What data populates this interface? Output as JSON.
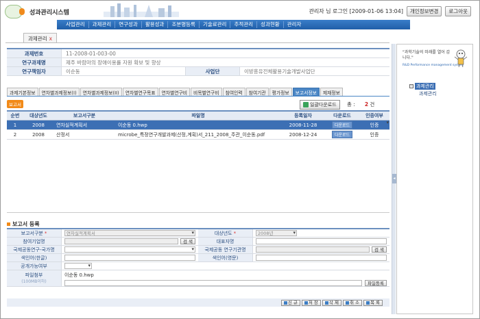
{
  "header": {
    "system_name": "성과관리시스템",
    "logo_text": "생각 누리",
    "user_status": "관리자 님 로그인 [2009-01-06 13:04]",
    "btn_profile": "개인정보변경",
    "btn_logout": "로그아웃"
  },
  "nav": [
    "사업관리",
    "과제관리",
    "연구성과",
    "활용성과",
    "조분명등록",
    "기술료관리",
    "추적관리",
    "성과현황",
    "관리자"
  ],
  "top_tab": {
    "label": "과제관리",
    "close": "x"
  },
  "info": {
    "rows": [
      {
        "label": "과제번호",
        "value": "11-2008-01-003-00"
      },
      {
        "label": "연구과제명",
        "value": "제주 바람마의 장애이용률 자원 확보 및 향상"
      },
      {
        "label": "연구책임자",
        "value": "이순동",
        "label2": "사업단",
        "value2": "이방흥유전체활용기술개발사업단"
      }
    ]
  },
  "tabs": [
    "과제기본정보",
    "연차별과제정보(I)",
    "연차별과제정보(II)",
    "연차별연구목표",
    "연차별연구비",
    "비목별연구비",
    "참여인력",
    "참여기관",
    "평가정보",
    "보고서정보",
    "제재정보"
  ],
  "active_tab_index": 9,
  "list": {
    "badge": "보고서",
    "download_all": "일괄다운로드",
    "total_label": "총 :",
    "total_count": "2",
    "total_unit": "건",
    "columns": [
      "순번",
      "대상년도",
      "보고서구분",
      "파일명",
      "등록일자",
      "다운로드",
      "인증여부"
    ],
    "rows": [
      {
        "no": "1",
        "year": "2008",
        "type": "연차실적계획서",
        "file": "이순동 0.hwp",
        "date": "2008-11-28",
        "dl": "다운로드",
        "cert": "인증"
      },
      {
        "no": "2",
        "year": "2008",
        "type": "산정서",
        "file": "microbe_특정연구개발과제(산정,계획)서_211_2008_주관_이순동.pdf",
        "date": "2008-12-24",
        "dl": "다운로드",
        "cert": "인증"
      }
    ]
  },
  "form": {
    "title": "보고서 등록",
    "type_label": "보고서구분",
    "type_value": "연차실적계획서",
    "year_label": "대상년도",
    "year_value": "2008년",
    "org_label": "참여기업명",
    "search_label": "검 색",
    "rep_label": "대표자명",
    "intl_label": "국제공동연구-국가명",
    "intl_org_label": "국제공동 연구기관명",
    "index_kr_label": "색인어(한글)",
    "index_en_label": "색인어(영문)",
    "public_label": "공개가능여부",
    "file_label": "파일첨부",
    "file_limit": "(100MB이하)",
    "file_name": "이순동 0.hwp",
    "file_btn": "파일등록"
  },
  "actions": [
    "신 규",
    "저 장",
    "삭 제",
    "취 소",
    "목 록"
  ],
  "right": {
    "promo_line1": "\"과학기술의 미래를 열어 갑니다.\"",
    "promo_line2": "R&D Performance management system",
    "tree_root": "과제관리",
    "tree_child": "과제관리"
  },
  "colors": {
    "nav": "#1f5ea8",
    "accent": "#4a86c5",
    "badge": "#f28a18"
  }
}
